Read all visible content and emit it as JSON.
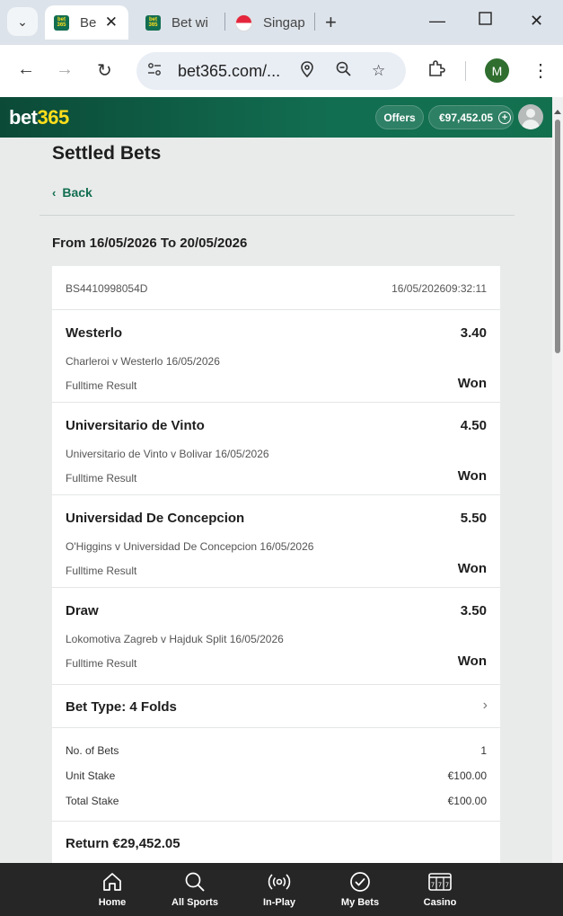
{
  "browser": {
    "tabs": [
      {
        "title": "Be",
        "favicon_text": "bet 365",
        "active": true
      },
      {
        "title": "Bet wi",
        "favicon_text": "bet 365",
        "active": false
      },
      {
        "title": "Singap",
        "active": false
      }
    ],
    "url": "bet365.com/...",
    "profile_initial": "M"
  },
  "header": {
    "logo_word": "bet",
    "logo_number": "365",
    "offers_label": "Offers",
    "balance": "€97,452.05",
    "balance_plus": "+"
  },
  "page": {
    "title": "Settled Bets",
    "back_label": "Back",
    "date_range": "From 16/05/2026 To 20/05/2026"
  },
  "bet": {
    "id": "BS4410998054D",
    "datetime": "16/05/202609:32:11",
    "selections": [
      {
        "name": "Westerlo",
        "odds": "3.40",
        "event": "Charleroi v Westerlo 16/05/2026",
        "market": "Fulltime Result",
        "result": "Won"
      },
      {
        "name": "Universitario de Vinto",
        "odds": "4.50",
        "event": "Universitario de Vinto v Bolivar 16/05/2026",
        "market": "Fulltime Result",
        "result": "Won"
      },
      {
        "name": "Universidad De Concepcion",
        "odds": "5.50",
        "event": "O'Higgins v Universidad De Concepcion 16/05/2026",
        "market": "Fulltime Result",
        "result": "Won"
      },
      {
        "name": "Draw",
        "odds": "3.50",
        "event": "Lokomotiva Zagreb v Hajduk Split 16/05/2026",
        "market": "Fulltime Result",
        "result": "Won"
      }
    ],
    "bet_type": "Bet Type: 4 Folds",
    "stakes": [
      {
        "label": "No. of Bets",
        "value": "1"
      },
      {
        "label": "Unit Stake",
        "value": "€100.00"
      },
      {
        "label": "Total Stake",
        "value": "€100.00"
      }
    ],
    "return": "Return €29,452.05"
  },
  "bottom_nav": [
    {
      "label": "Home",
      "icon": "home-icon"
    },
    {
      "label": "All Sports",
      "icon": "search-icon"
    },
    {
      "label": "In-Play",
      "icon": "broadcast-icon"
    },
    {
      "label": "My Bets",
      "icon": "check-circle-icon"
    },
    {
      "label": "Casino",
      "icon": "slot-machine-icon"
    }
  ],
  "colors": {
    "brand_green": "#126e51",
    "brand_yellow": "#ffdf1b",
    "nav_bg": "#262626"
  }
}
